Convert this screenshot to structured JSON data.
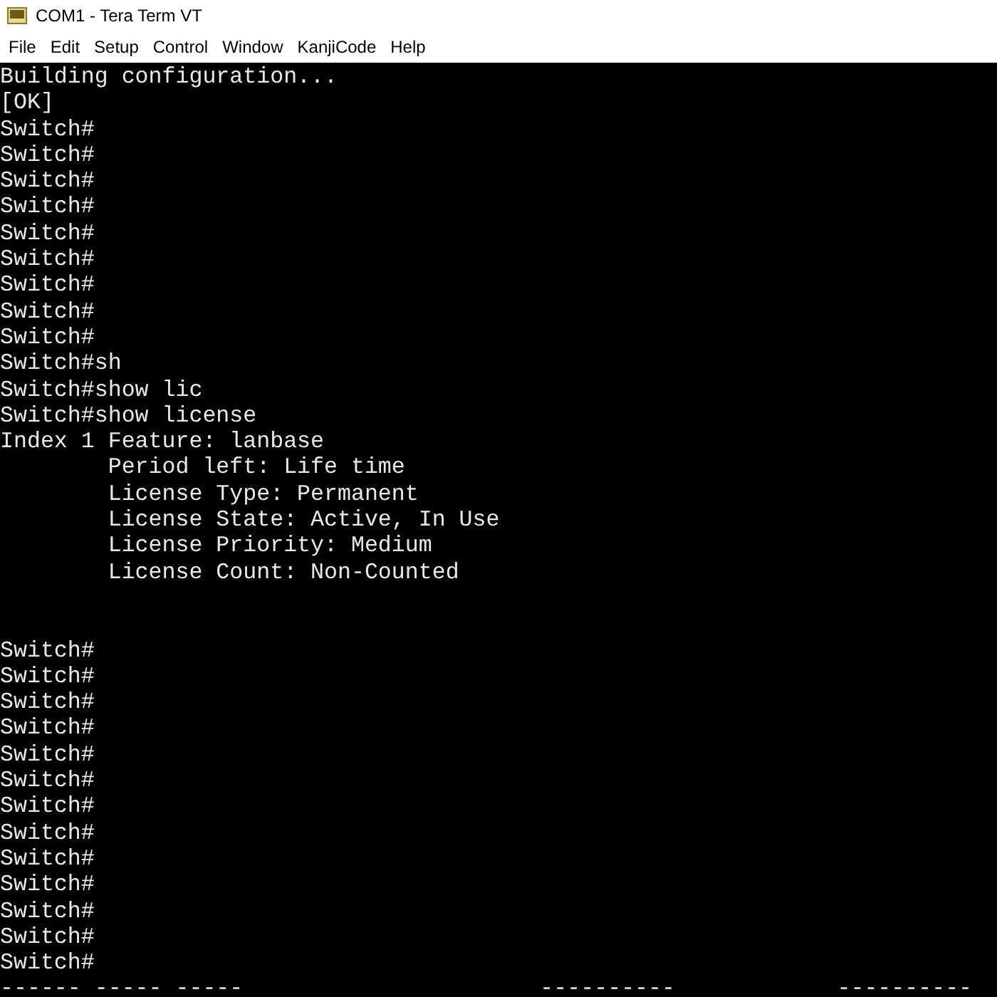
{
  "window": {
    "title": "COM1 - Tera Term VT"
  },
  "menu": [
    "File",
    "Edit",
    "Setup",
    "Control",
    "Window",
    "KanjiCode",
    "Help"
  ],
  "terminal": {
    "blocks": [
      [
        "Building configuration...",
        "[OK]",
        "Switch#",
        "Switch#",
        "Switch#",
        "Switch#",
        "Switch#",
        "Switch#",
        "Switch#",
        "Switch#",
        "Switch#",
        "Switch#sh",
        "Switch#show lic",
        "Switch#show license",
        "Index 1 Feature: lanbase",
        "        Period left: Life time",
        "        License Type: Permanent",
        "        License State: Active, In Use",
        "        License Priority: Medium",
        "        License Count: Non-Counted"
      ],
      [
        "Switch#",
        "Switch#",
        "Switch#",
        "Switch#",
        "Switch#",
        "Switch#",
        "Switch#",
        "Switch#",
        "Switch#",
        "Switch#",
        "Switch#",
        "Switch#",
        "Switch#",
        "------ ----- -----                      ----------            ----------"
      ]
    ]
  }
}
